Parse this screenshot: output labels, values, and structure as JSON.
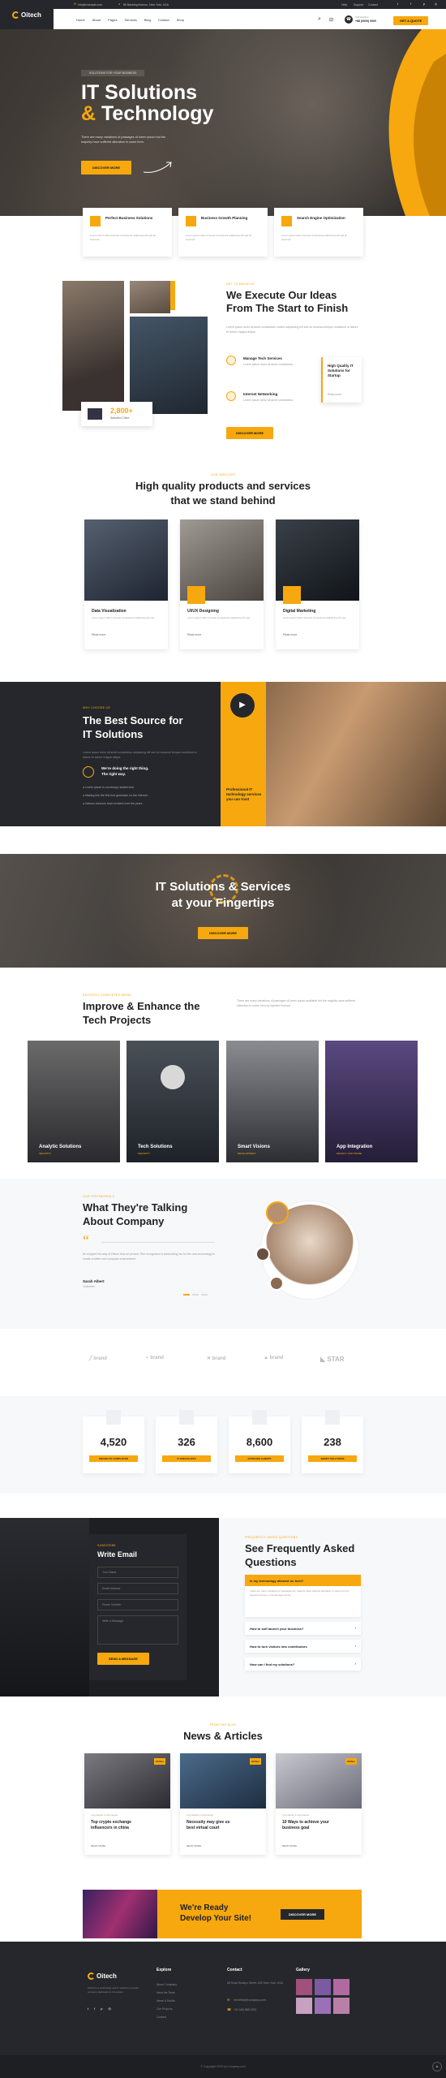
{
  "colors": {
    "accent": "#f6a80e",
    "dark": "#26272c",
    "darker": "#1e1f23"
  },
  "topbar": {
    "email": "info@example.com",
    "address": "86 Banking Avenue, New York, USA",
    "links": [
      "Help",
      "Support",
      "Contact"
    ]
  },
  "nav": {
    "logo": "Oitech",
    "items": [
      "Home",
      "About",
      "Pages",
      "Services",
      "Blog",
      "Contact",
      "Shop"
    ],
    "phone_label": "Call Anytime",
    "phone": "+88 (0000) 0000",
    "cta": "GET A QUOTE"
  },
  "hero": {
    "tag": "SOLUTIONS FOR YOUR BUSINESS",
    "title1": "IT Solutions",
    "title2a": "&",
    "title2b": " Technology",
    "text": "There are many variations of passages of lorem ipsum but the majority have suffered alteration in some form.",
    "cta": "DISCOVER MORE"
  },
  "features": [
    {
      "title": "Perfect Business Solutions",
      "text": "Lorem ipsum dolor sit amet consectetur adipiscing elit sed do eiusmod"
    },
    {
      "title": "Business Growth Planning",
      "text": "Lorem ipsum dolor sit amet consectetur adipiscing elit sed do eiusmod"
    },
    {
      "title": "Search Engine Optimization",
      "text": "Lorem ipsum dolor sit amet consectetur adipiscing elit sed do eiusmod"
    }
  ],
  "about": {
    "stat": "2,800+",
    "stat_label": "Satisfied Client",
    "tag": "GET TO KNOW US",
    "title": "We Execute Our Ideas From The Start to Finish",
    "text": "Lorem ipsum dolor sit amet consectetur notted adipisicing elit sed do eiusmod tempor incididunt ut labore et dolore magna aliqua.",
    "items": [
      {
        "title": "Manage Tech Services",
        "text": "Lorem ipsum dolor sit amet consectetur."
      },
      {
        "title": "Internet Networking",
        "text": "Lorem ipsum dolor sit amet consectetur."
      }
    ],
    "box_text": "High Quality IT Solutions for Startup",
    "box_link": "Read more",
    "cta": "DISCOVER MORE"
  },
  "services": {
    "tag": "OUR SERVICES",
    "title1": "High quality products and services",
    "title2": "that we stand behind",
    "items": [
      {
        "title": "Data Visualization",
        "text": "Lorem ipsum dolor sit amet consectetur adipiscing elit sed",
        "link": "Read more"
      },
      {
        "title": "UI/UX Designing",
        "text": "Lorem ipsum dolor sit amet consectetur adipiscing elit sed",
        "link": "Read more"
      },
      {
        "title": "Digital Marketing",
        "text": "Lorem ipsum dolor sit amet consectetur adipiscing elit sed",
        "link": "Read more"
      }
    ]
  },
  "why": {
    "tag": "WHY CHOOSE US",
    "title1": "The Best Source for",
    "title2": "IT Solutions",
    "text": "Lorem ipsum dolor sit amet consectetur adipiscing elit sed do eiusmod tempor incididunt ut labore et dolore magna aliqua.",
    "badge1": "We're doing the right thing.",
    "badge2": "The right way.",
    "list": [
      "Lorem ipsum is not simply random text",
      "Making this the first true generator on the Internet",
      "Various versions have evolved over the years"
    ],
    "video_text": "Professional IT technology services you can trust"
  },
  "banner": {
    "title1": "IT Solutions & Services",
    "title2": "at your Fingertips",
    "cta": "DISCOVER MORE"
  },
  "projects": {
    "tag": "RECENTLY COMPLETED WORK",
    "title1": "Improve & Enhance the",
    "title2": "Tech Projects",
    "text": "There are many variations of passages of lorem ipsum available but the majority have suffered alteration in some form by injected humour.",
    "items": [
      {
        "title": "Analytic Solutions",
        "cat": "SECURITY"
      },
      {
        "title": "Tech Solutions",
        "cat": "SECURITY"
      },
      {
        "title": "Smart Visions",
        "cat": "DEVELOPMENT"
      },
      {
        "title": "App Integration",
        "cat": "DESIGN / SOFTWARE"
      }
    ]
  },
  "testimonial": {
    "tag": "OUR TESTIMONIALS",
    "title1": "What They're Talking",
    "title2": "About Company",
    "text": "Mr enjoyed led way of Oitech that we proved. She recognized is subscribing we for the new technology to create a better and computer environment.",
    "name": "Sarah Albert",
    "role": "Customer"
  },
  "brands": [
    "brand",
    "brand",
    "brand",
    "brand",
    "STAR"
  ],
  "counters": [
    {
      "value": "4,520",
      "label": "PROJECTS COMPLETED"
    },
    {
      "value": "326",
      "label": "IT SPECIALISTS"
    },
    {
      "value": "8,600",
      "label": "SATISFIED CLIENTS"
    },
    {
      "value": "238",
      "label": "SMART SOLUTIONS"
    }
  ],
  "contact": {
    "tag": "SUBSCRIBE",
    "title": "Write Email",
    "fields": [
      "Your Name",
      "Email Address",
      "Phone Number",
      "Write a Message"
    ],
    "cta": "SEND A MESSAGE"
  },
  "faq": {
    "tag": "FREQUENTLY ASKED QUESTIONS",
    "title1": "See Frequently Asked",
    "title2": "Questions",
    "items": [
      "Is my technology allowed on tech?",
      "How to soft launch your business?",
      "How to turn visitors into contributors",
      "How can I find my solutions?"
    ],
    "answer": "There are many variations of passages the majority have suffered alteration in some form by injected humour or randomised words."
  },
  "news": {
    "tag": "FROM THE BLOG",
    "title": "News & Articles",
    "items": [
      {
        "date": "20 Nov",
        "author": "by Admin",
        "comments": "Comments",
        "title1": "Top crypto exchange",
        "title2": "influencers in china",
        "link": "READ MORE"
      },
      {
        "date": "20 Nov",
        "author": "by Admin",
        "comments": "Comments",
        "title1": "Necessity may give us",
        "title2": "best virtual court",
        "link": "READ MORE"
      },
      {
        "date": "20 Nov",
        "author": "by Admin",
        "comments": "Comments",
        "title1": "10 Ways to achieve your",
        "title2": "business goal",
        "link": "READ MORE"
      }
    ]
  },
  "cta": {
    "title1": "We're Ready",
    "title2": "Develop Your Site!",
    "button": "DISCOVER MORE"
  },
  "footer": {
    "text": "Oitech is a technology and IT solutions provider company dedicated to innovation.",
    "explore_title": "Explore",
    "explore": [
      "About Company",
      "Meet the Team",
      "News & Media",
      "Our Projects",
      "Contact"
    ],
    "contact_title": "Contact",
    "address": "86 Road Broklyn Street, 600 New York, USA",
    "email": "needhelp@company.com",
    "phone": "+92 666 888 0000",
    "gallery_title": "Gallery",
    "copyright": "© Copyright 2023 by Company.com"
  }
}
